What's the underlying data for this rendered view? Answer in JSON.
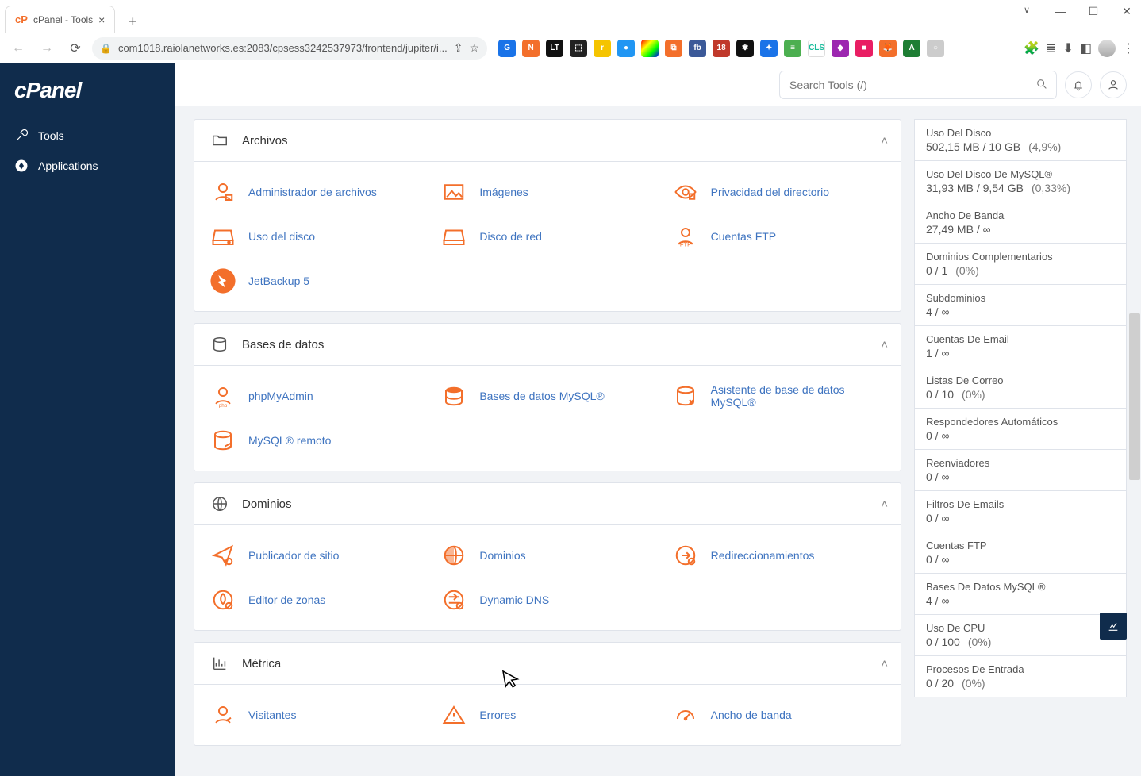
{
  "browser": {
    "tab_title": "cPanel - Tools",
    "url": "com1018.raiolanetworks.es:2083/cpsess3242537973/frontend/jupiter/i..."
  },
  "app": {
    "logo": "cPanel",
    "nav": {
      "tools": "Tools",
      "applications": "Applications"
    },
    "search_placeholder": "Search Tools (/)"
  },
  "sections": {
    "archivos": {
      "title": "Archivos",
      "items": [
        "Administrador de archivos",
        "Imágenes",
        "Privacidad del directorio",
        "Uso del disco",
        "Disco de red",
        "Cuentas FTP",
        "JetBackup 5"
      ]
    },
    "db": {
      "title": "Bases de datos",
      "items": [
        "phpMyAdmin",
        "Bases de datos MySQL®",
        "Asistente de base de datos MySQL®",
        "MySQL® remoto"
      ]
    },
    "dominios": {
      "title": "Dominios",
      "items": [
        "Publicador de sitio",
        "Dominios",
        "Redireccionamientos",
        "Editor de zonas",
        "Dynamic DNS"
      ]
    },
    "metrica": {
      "title": "Métrica",
      "items": [
        "Visitantes",
        "Errores",
        "Ancho de banda"
      ]
    }
  },
  "stats": [
    {
      "label": "Uso Del Disco",
      "value": "502,15 MB / 10 GB",
      "pct": "(4,9%)"
    },
    {
      "label": "Uso Del Disco De MySQL®",
      "value": "31,93 MB / 9,54 GB",
      "pct": "(0,33%)"
    },
    {
      "label": "Ancho De Banda",
      "value": "27,49 MB / ∞",
      "pct": ""
    },
    {
      "label": "Dominios Complementarios",
      "value": "0 / 1",
      "pct": "(0%)"
    },
    {
      "label": "Subdominios",
      "value": "4 / ∞",
      "pct": ""
    },
    {
      "label": "Cuentas De Email",
      "value": "1 / ∞",
      "pct": ""
    },
    {
      "label": "Listas De Correo",
      "value": "0 / 10",
      "pct": "(0%)"
    },
    {
      "label": "Respondedores Automáticos",
      "value": "0 / ∞",
      "pct": ""
    },
    {
      "label": "Reenviadores",
      "value": "0 / ∞",
      "pct": ""
    },
    {
      "label": "Filtros De Emails",
      "value": "0 / ∞",
      "pct": ""
    },
    {
      "label": "Cuentas FTP",
      "value": "0 / ∞",
      "pct": ""
    },
    {
      "label": "Bases De Datos MySQL®",
      "value": "4 / ∞",
      "pct": ""
    },
    {
      "label": "Uso De CPU",
      "value": "0 / 100",
      "pct": "(0%)"
    },
    {
      "label": "Procesos De Entrada",
      "value": "0 / 20",
      "pct": "(0%)"
    }
  ]
}
